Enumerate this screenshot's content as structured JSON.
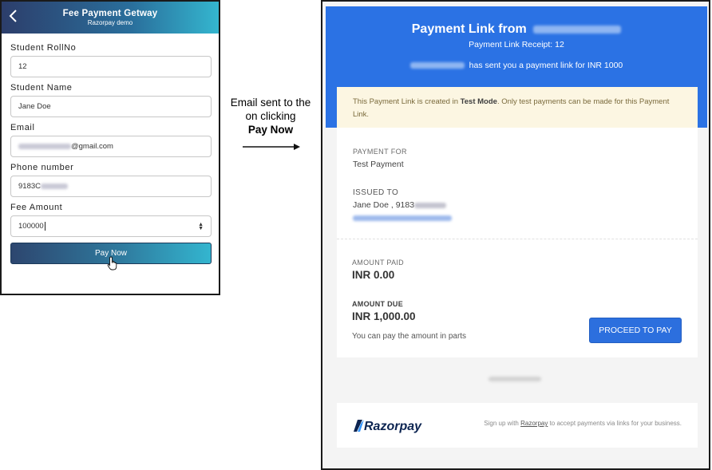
{
  "app": {
    "title": "Fee Payment Getway",
    "subtitle": "Razorpay demo",
    "fields": [
      {
        "label": "Student RollNo",
        "value": "12"
      },
      {
        "label": "Student Name",
        "value": "Jane Doe"
      },
      {
        "label": "Email",
        "value": "@gmail.com"
      },
      {
        "label": "Phone number",
        "value": "9183C"
      },
      {
        "label": "Fee Amount",
        "value": "100000"
      }
    ],
    "pay_button": "Pay Now"
  },
  "annotation": {
    "line1": "Email sent to the",
    "line2": "on clicking",
    "line3": "Pay Now"
  },
  "email": {
    "title": "Payment Link from",
    "receipt": "Payment Link Receipt: 12",
    "sent_text": "has sent you a payment link for INR 1000",
    "test_mode": {
      "before": "This Payment Link is created in ",
      "bold": "Test Mode",
      "after": ". Only test payments can be made for this Payment Link."
    },
    "payment_for_label": "PAYMENT FOR",
    "payment_for_value": "Test Payment",
    "issued_to_label": "ISSUED TO",
    "issued_to_value": "Jane Doe , 9183",
    "amount_paid_label": "AMOUNT PAID",
    "amount_paid_value": "INR 0.00",
    "amount_due_label": "AMOUNT DUE",
    "amount_due_value": "INR 1,000.00",
    "parts_note": "You can pay the amount in parts",
    "proceed_button": "PROCEED TO PAY",
    "footer": {
      "brand": "Razorpay",
      "text_before": "Sign up with ",
      "link": "Razorpay",
      "text_after": " to accept payments via links for your business."
    }
  },
  "colors": {
    "hero_blue": "#2b72e4",
    "button_blue": "#2c6fde",
    "header_gradient_start": "#2c3e6b",
    "header_gradient_end": "#34b6cf",
    "test_mode_bg": "#fcf6e2"
  }
}
